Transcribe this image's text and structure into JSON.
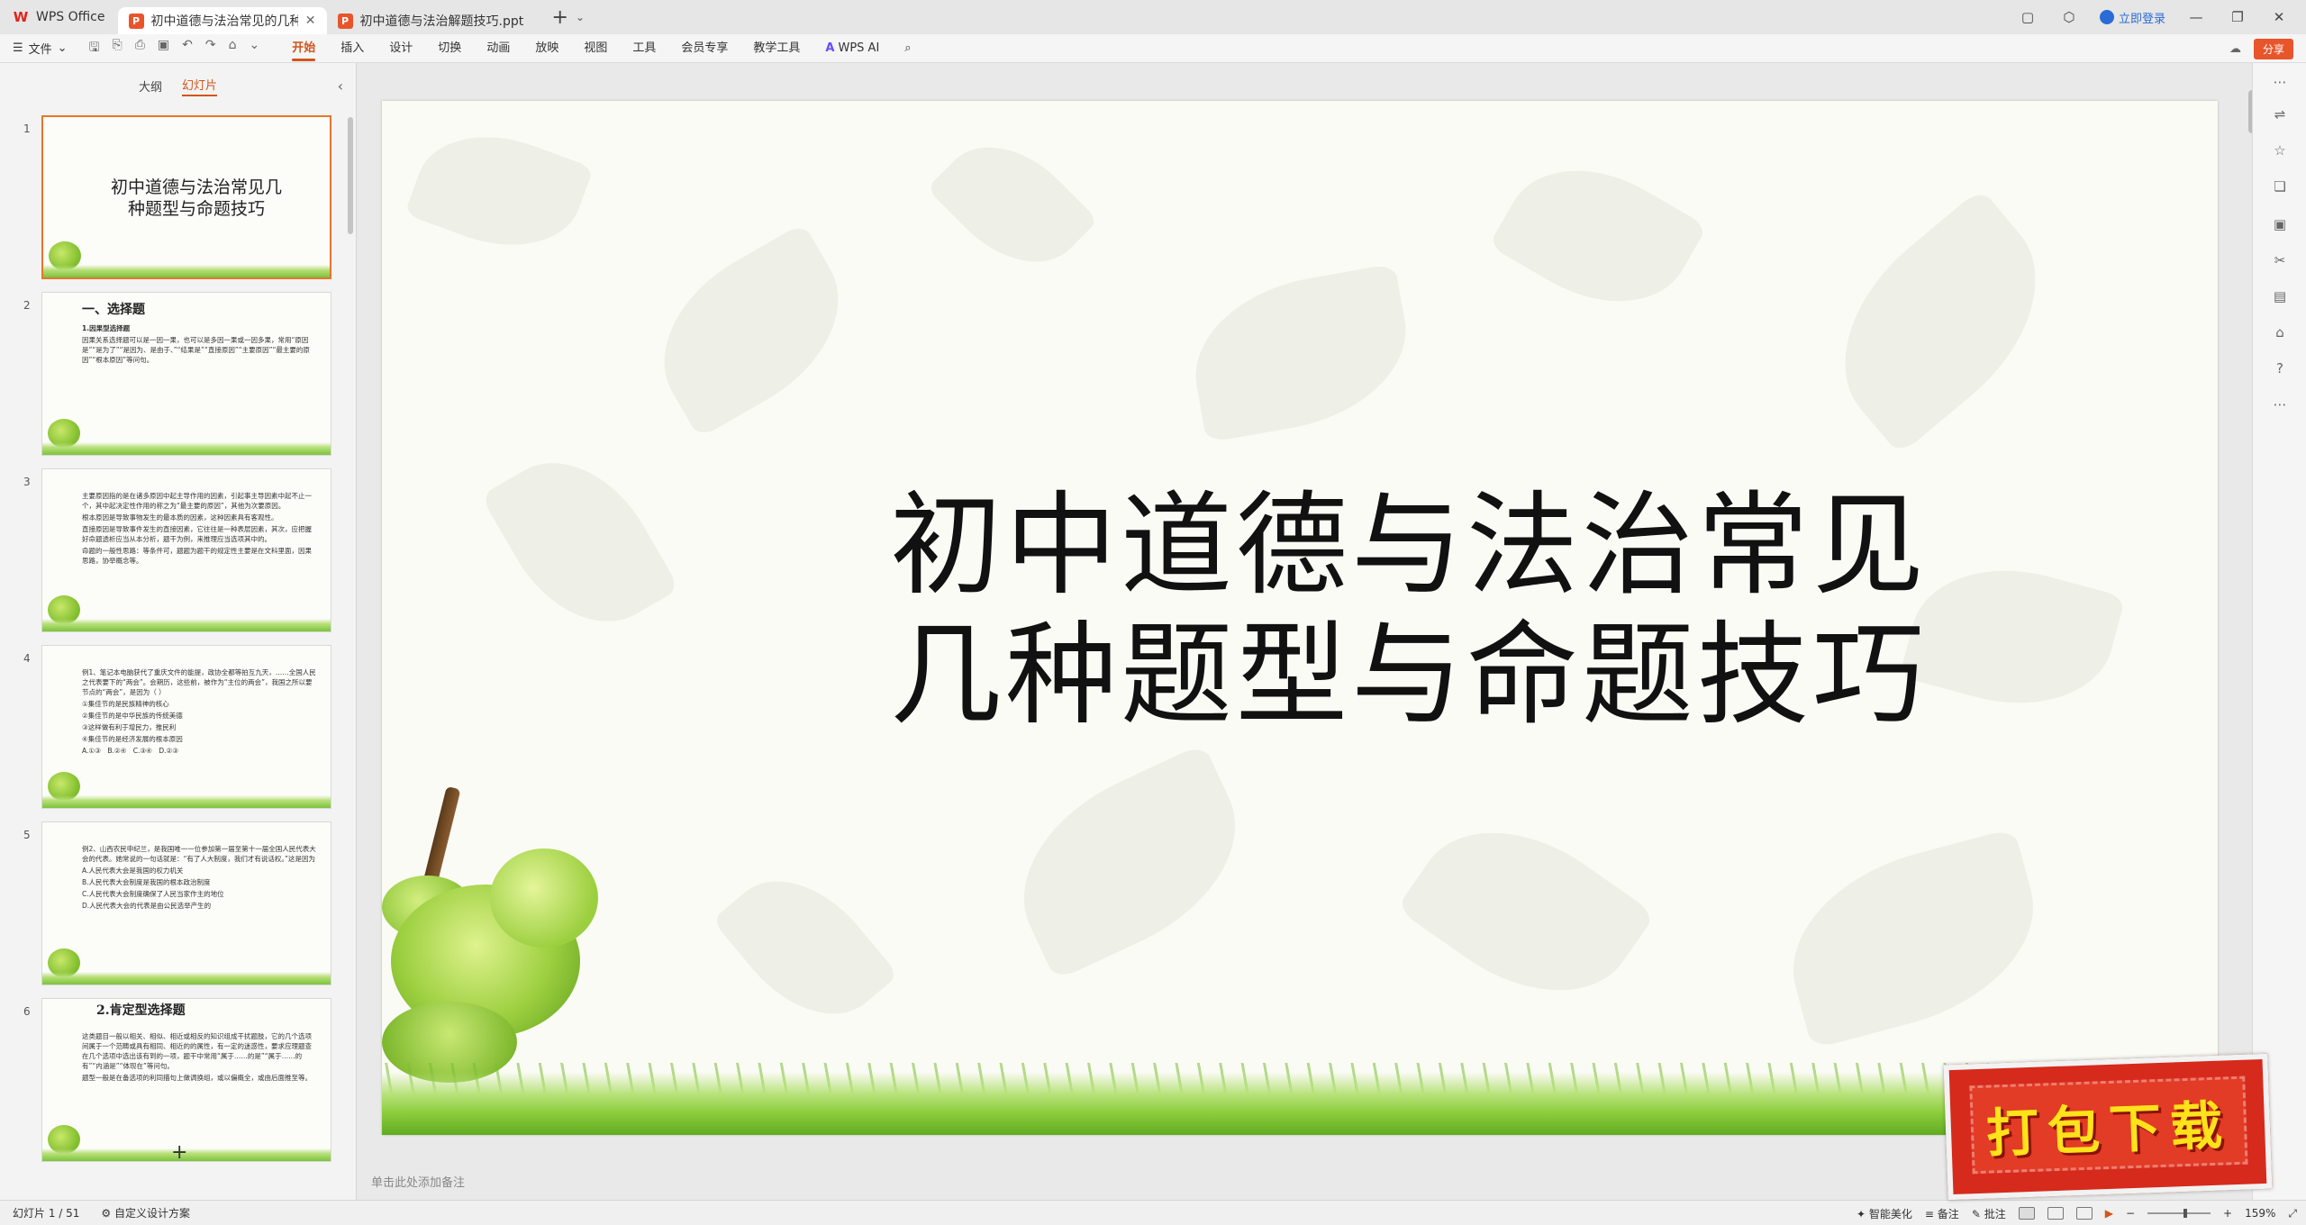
{
  "titlebar": {
    "app_name": "WPS Office",
    "tabs": [
      {
        "label": "初中道德与法治常见的几种题",
        "active": true
      },
      {
        "label": "初中道德与法治解题技巧.ppt",
        "active": false
      }
    ],
    "login_label": "立即登录"
  },
  "menubar": {
    "file_label": "文件",
    "items": [
      "开始",
      "插入",
      "设计",
      "切换",
      "动画",
      "放映",
      "视图",
      "工具",
      "会员专享",
      "教学工具"
    ],
    "active_item": "开始",
    "wps_ai_label": "WPS AI",
    "share_label": "分享"
  },
  "leftpanel": {
    "tabs": [
      "大纲",
      "幻灯片"
    ],
    "active_tab": "幻灯片",
    "slides": [
      {
        "num": "1",
        "title": "初中道德与法治常见几种题型与命题技巧"
      },
      {
        "num": "2",
        "heading": "一、选择题",
        "lines": [
          "1.因果型选择题",
          "因果关系选择题可以是一因一果，也可以是多因一果或一因多果，常用“原因是”“是为了”“是因为、是由于、”“结果是”“直接原因”“主要原因”“最主要的原因”“根本原因”等问句。"
        ]
      },
      {
        "num": "3",
        "lines": [
          "主要原因指的是在诸多原因中起主导作用的因素，引起事主导因素中起不止一个，其中起决定性作用的称之为“最主要的原因”，其他为次要原因。",
          "根本原因是导致事物发生的最本质的因素，这种因素具有客观性。",
          "直接原因是导致事件发生的直接因素，它往往是一种表层因素，其次，应把握好命题透析应当从本分析，题干为例，来推理应当选项其中的。",
          "命题的一般性思路：等条件可，题题为题干的规定性主要是在文科里面，因果思路，协举概念等。"
        ]
      },
      {
        "num": "4",
        "lines": [
          "例1、笔记本电脑获代了重庆文件的能提，政协全都等拍互九天，……全国人民之代表要下的“两会”。会期历，这些前，被作为“主位的两会”，我国之所以要节点的“两会”，是因为（ ）",
          "①集佳节的是民族精神的核心",
          "②集佳节的是中华民族的传统美德",
          "③这样做有利于增民力，推民利",
          "④集佳节的是经济发展的根本原因",
          "A.①③　B.②④　C.③④　D.②③"
        ]
      },
      {
        "num": "5",
        "lines": [
          "例2、山西农民申纪兰，是我国唯一一位参加第一届至第十一届全国人民代表大会的代表。她常说的一句话就是：“有了人大制度，我们才有说话权。”这是因为",
          "A.人民代表大会是我国的权力机关",
          "B.人民代表大会制度是我国的根本政治制度",
          "C.人民代表大会制度确保了人民当家作主的地位",
          "D.人民代表大会的代表是由公民选举产生的"
        ]
      },
      {
        "num": "6",
        "heading": "2.肯定型选择题",
        "lines": [
          "这类题目一般以相关、相似、相近或相反的知识组成干扰题肢，它的几个选项间属于一个范畴或具有相同、相近的的属性，有一定的迷惑性，要求应理题查在几个选项中选出该有到的一项，题干中常用“属于……的是”“属于……的有”“内涵是”“体现在”等问句。",
          "题型一般是在备选项的利同描句上做调换组，或以偏概全，或由后面推至等。"
        ]
      }
    ]
  },
  "slide": {
    "title_line1": "初中道德与法治常见",
    "title_line2": "几种题型与命题技巧"
  },
  "notes_placeholder": "单击此处添加备注",
  "statusbar": {
    "slide_counter": "幻灯片 1 / 51",
    "design_label": "自定义设计方案",
    "smart_beautify": "智能美化",
    "notes_label": "备注",
    "comments_label": "批注",
    "zoom_level": "159%"
  },
  "badge": {
    "text": "打包下载"
  }
}
